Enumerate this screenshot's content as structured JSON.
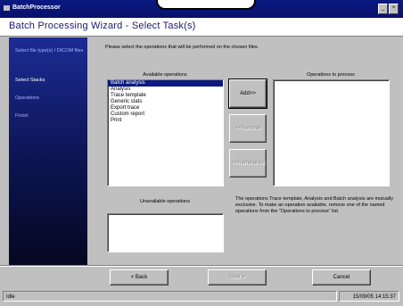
{
  "window": {
    "title": "BatchProcessor"
  },
  "header": {
    "title": "Batch Processing Wizard - Select Task(s)"
  },
  "sidebar": {
    "items": [
      {
        "label": "Select file type(s) / DICOM files",
        "current": false
      },
      {
        "label": "Select Stacks",
        "current": true
      },
      {
        "label": "Operations",
        "current": false
      },
      {
        "label": "Finish",
        "current": false
      }
    ]
  },
  "main": {
    "instruction": "Please select the operations that will be performed on the chosen files.",
    "available_label": "Available operations",
    "available_items": [
      "Batch analysis",
      "Analysis",
      "Trace template",
      "Generic stats",
      "Export trace",
      "Custom report",
      "Print"
    ],
    "to_process_label": "Operations to process",
    "to_process_items": [],
    "unavailable_label": "Unavailable operations",
    "unavailable_items": [],
    "add_label": "Add>>",
    "remove_label": "<<Remove",
    "remove_all_label": "<<Remove All",
    "info": "The operations Trace template, Analysis and Batch analysis are mutually exclusive. To make an operation available, remove one of the named operations from the \"Operations to process\" list."
  },
  "footer": {
    "back_label": "< Back",
    "next_label": "Next >",
    "cancel_label": "Cancel"
  },
  "status": {
    "left": "Idle",
    "right": "15/09/05 14:15:37"
  }
}
